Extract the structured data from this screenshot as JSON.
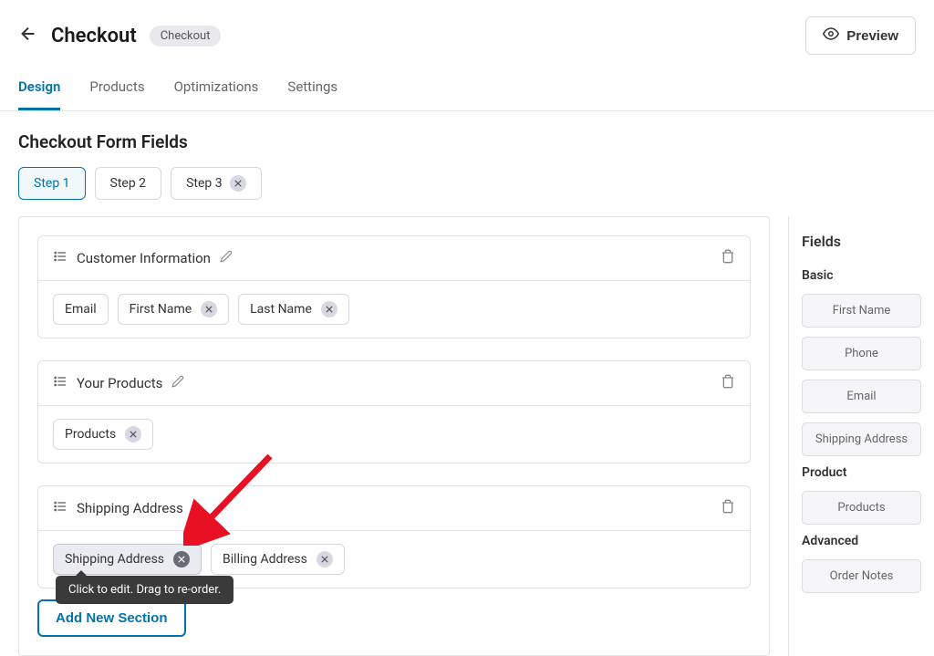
{
  "header": {
    "title": "Checkout",
    "badge": "Checkout",
    "preview_label": "Preview"
  },
  "tabs": [
    "Design",
    "Products",
    "Optimizations",
    "Settings"
  ],
  "active_tab": 0,
  "section_title": "Checkout Form Fields",
  "steps": [
    {
      "label": "Step 1",
      "removable": false,
      "active": true
    },
    {
      "label": "Step 2",
      "removable": false,
      "active": false
    },
    {
      "label": "Step 3",
      "removable": true,
      "active": false
    }
  ],
  "sections": [
    {
      "title": "Customer Information",
      "editable": true,
      "fields": [
        {
          "label": "Email",
          "removable": false,
          "highlighted": false
        },
        {
          "label": "First Name",
          "removable": true,
          "highlighted": false
        },
        {
          "label": "Last Name",
          "removable": true,
          "highlighted": false
        }
      ]
    },
    {
      "title": "Your Products",
      "editable": true,
      "fields": [
        {
          "label": "Products",
          "removable": true,
          "highlighted": false
        }
      ]
    },
    {
      "title": "Shipping Address",
      "editable": false,
      "fields": [
        {
          "label": "Shipping Address",
          "removable": true,
          "highlighted": true
        },
        {
          "label": "Billing Address",
          "removable": true,
          "highlighted": false
        }
      ]
    }
  ],
  "tooltip": "Click to edit. Drag to re-order.",
  "add_section_label": "Add New Section",
  "sidebar": {
    "title": "Fields",
    "groups": [
      {
        "title": "Basic",
        "items": [
          "First Name",
          "Phone",
          "Email",
          "Shipping Address"
        ]
      },
      {
        "title": "Product",
        "items": [
          "Products"
        ]
      },
      {
        "title": "Advanced",
        "items": [
          "Order Notes"
        ]
      }
    ]
  }
}
